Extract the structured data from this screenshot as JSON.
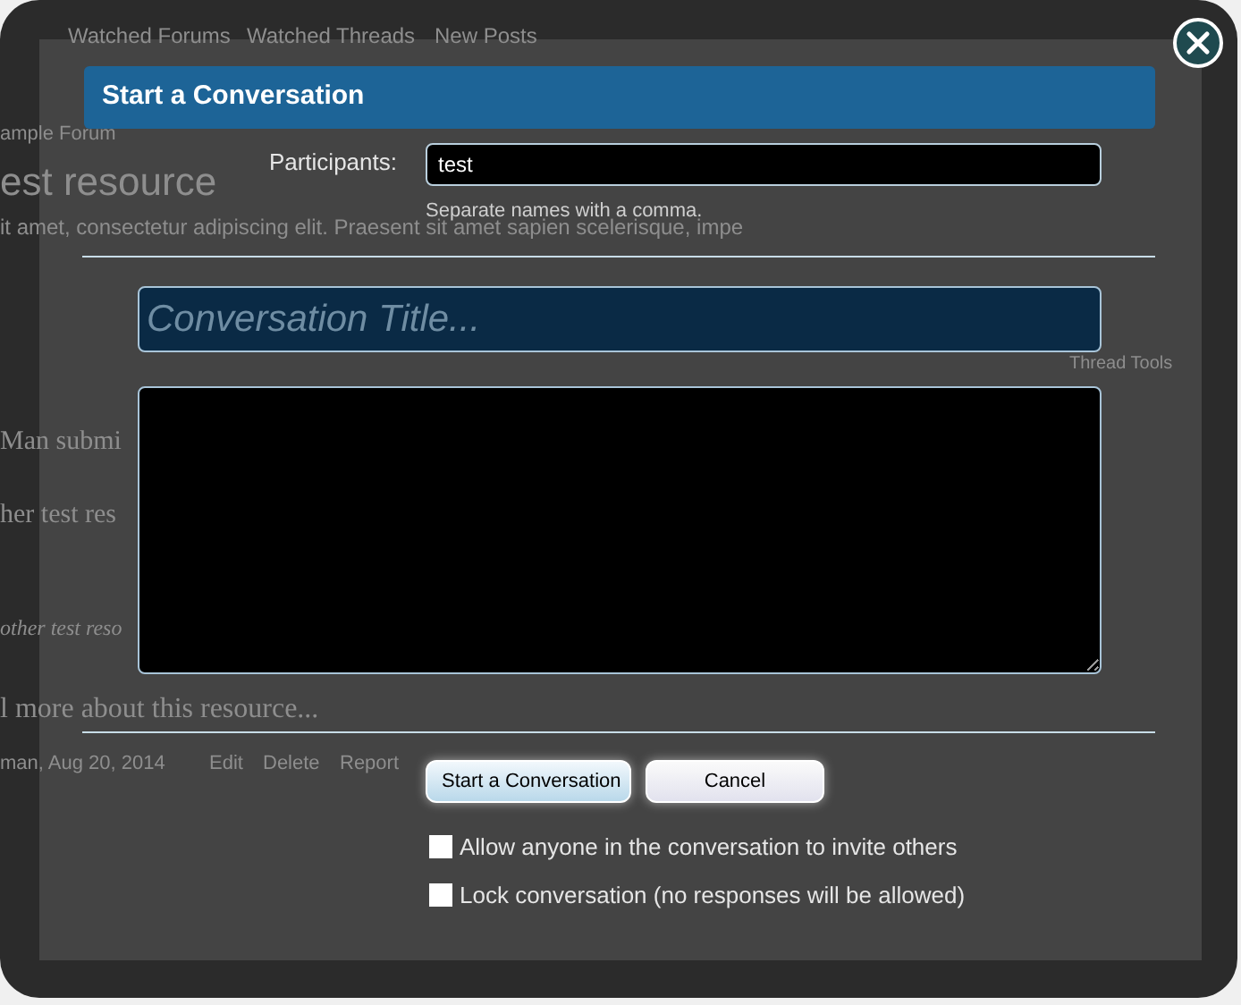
{
  "background_page": {
    "nav_links": [
      "Watched Forums",
      "Watched Threads",
      "New Posts"
    ],
    "breadcrumb": "ample Forum",
    "title": "est resource",
    "tagline": "it amet, consectetur adipiscing elit. Praesent sit amet sapien scelerisque, impe",
    "thread_tools": "Thread Tools",
    "lines": [
      {
        "kind": "plain",
        "text": "Man submi"
      },
      {
        "kind": "plain",
        "text": "her test res"
      },
      {
        "kind": "italic",
        "text": "other test reso"
      },
      {
        "kind": "heading",
        "text": "l more about this resource..."
      }
    ],
    "meta": "man, Aug 20, 2014",
    "actions": [
      "Edit",
      "Delete",
      "Report"
    ]
  },
  "dialog": {
    "title": "Start a Conversation",
    "participants": {
      "label": "Participants:",
      "value": "test",
      "hint": "Separate names with a comma."
    },
    "title_field": {
      "placeholder": "Conversation Title..."
    },
    "buttons": [
      {
        "label": "Start a Conversation",
        "kind": "primary"
      },
      {
        "label": "Cancel",
        "kind": "secondary"
      }
    ],
    "options": [
      {
        "label": "Allow anyone in the conversation to invite others",
        "checked": false
      },
      {
        "label": "Lock conversation (no responses will be allowed)",
        "checked": false
      }
    ]
  }
}
